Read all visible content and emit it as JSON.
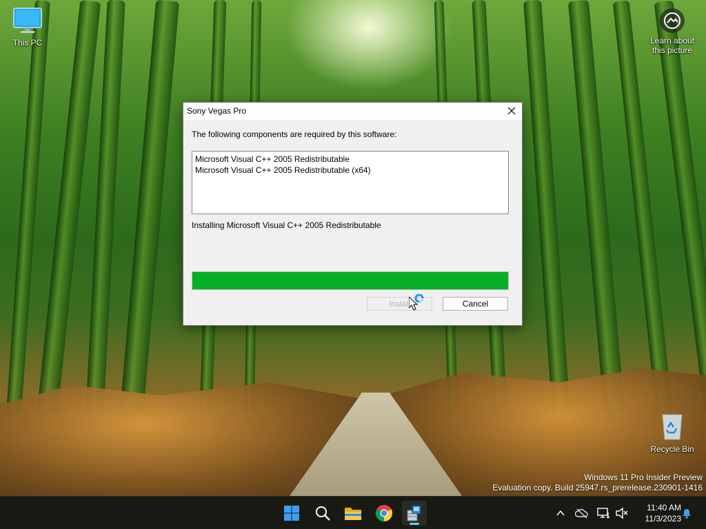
{
  "desktop": {
    "icons": {
      "this_pc": "This PC",
      "recycle_bin": "Recycle Bin",
      "learn_line1": "Learn about",
      "learn_line2": "this picture"
    },
    "watermark": {
      "line1": "Windows 11 Pro Insider Preview",
      "line2": "Evaluation copy. Build 25947.rs_prerelease.230901-1416"
    }
  },
  "dialog": {
    "title": "Sony Vegas Pro",
    "message": "The following components are required by this software:",
    "components": [
      "Microsoft Visual C++ 2005 Redistributable",
      "Microsoft Visual C++ 2005 Redistributable (x64)"
    ],
    "status": "Installing Microsoft Visual C++ 2005 Redistributable",
    "progress_percent": 100,
    "install_label": "Install",
    "cancel_label": "Cancel",
    "progress_color": "#06b025"
  },
  "taskbar": {
    "apps": [
      "start-icon",
      "search-icon",
      "file-explorer-icon",
      "chrome-icon",
      "installer-app-icon"
    ],
    "tray": [
      "chevron-up-icon",
      "onedrive-offline-icon",
      "network-icon",
      "volume-muted-icon",
      "notification-bell-icon"
    ],
    "time": "11:40 AM",
    "date": "11/3/2023"
  }
}
